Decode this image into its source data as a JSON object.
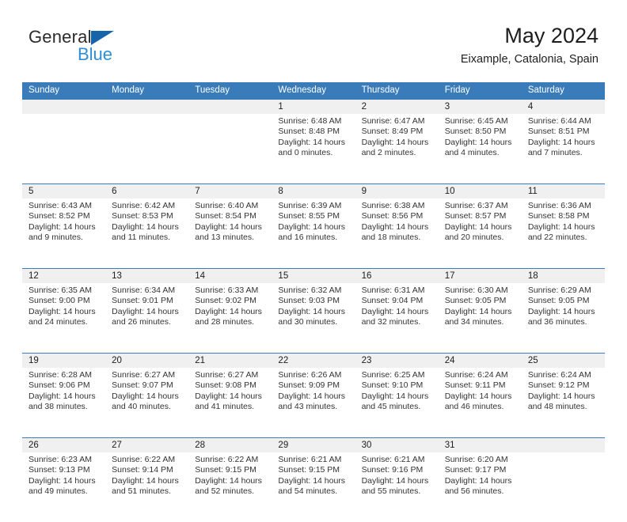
{
  "brand": {
    "name_part1": "General",
    "name_part2": "Blue",
    "triangle_color": "#1665ab",
    "blue_color": "#2e8fd6"
  },
  "header": {
    "title": "May 2024",
    "subtitle": "Eixample, Catalonia, Spain"
  },
  "theme": {
    "header_band": "#3a7cba",
    "daynum_band": "#f0f0f0",
    "text": "#333333"
  },
  "weekdays": [
    "Sunday",
    "Monday",
    "Tuesday",
    "Wednesday",
    "Thursday",
    "Friday",
    "Saturday"
  ],
  "weeks": [
    [
      {
        "day": "",
        "sunrise": "",
        "sunset": "",
        "daylight1": "",
        "daylight2": ""
      },
      {
        "day": "",
        "sunrise": "",
        "sunset": "",
        "daylight1": "",
        "daylight2": ""
      },
      {
        "day": "",
        "sunrise": "",
        "sunset": "",
        "daylight1": "",
        "daylight2": ""
      },
      {
        "day": "1",
        "sunrise": "Sunrise: 6:48 AM",
        "sunset": "Sunset: 8:48 PM",
        "daylight1": "Daylight: 14 hours",
        "daylight2": "and 0 minutes."
      },
      {
        "day": "2",
        "sunrise": "Sunrise: 6:47 AM",
        "sunset": "Sunset: 8:49 PM",
        "daylight1": "Daylight: 14 hours",
        "daylight2": "and 2 minutes."
      },
      {
        "day": "3",
        "sunrise": "Sunrise: 6:45 AM",
        "sunset": "Sunset: 8:50 PM",
        "daylight1": "Daylight: 14 hours",
        "daylight2": "and 4 minutes."
      },
      {
        "day": "4",
        "sunrise": "Sunrise: 6:44 AM",
        "sunset": "Sunset: 8:51 PM",
        "daylight1": "Daylight: 14 hours",
        "daylight2": "and 7 minutes."
      }
    ],
    [
      {
        "day": "5",
        "sunrise": "Sunrise: 6:43 AM",
        "sunset": "Sunset: 8:52 PM",
        "daylight1": "Daylight: 14 hours",
        "daylight2": "and 9 minutes."
      },
      {
        "day": "6",
        "sunrise": "Sunrise: 6:42 AM",
        "sunset": "Sunset: 8:53 PM",
        "daylight1": "Daylight: 14 hours",
        "daylight2": "and 11 minutes."
      },
      {
        "day": "7",
        "sunrise": "Sunrise: 6:40 AM",
        "sunset": "Sunset: 8:54 PM",
        "daylight1": "Daylight: 14 hours",
        "daylight2": "and 13 minutes."
      },
      {
        "day": "8",
        "sunrise": "Sunrise: 6:39 AM",
        "sunset": "Sunset: 8:55 PM",
        "daylight1": "Daylight: 14 hours",
        "daylight2": "and 16 minutes."
      },
      {
        "day": "9",
        "sunrise": "Sunrise: 6:38 AM",
        "sunset": "Sunset: 8:56 PM",
        "daylight1": "Daylight: 14 hours",
        "daylight2": "and 18 minutes."
      },
      {
        "day": "10",
        "sunrise": "Sunrise: 6:37 AM",
        "sunset": "Sunset: 8:57 PM",
        "daylight1": "Daylight: 14 hours",
        "daylight2": "and 20 minutes."
      },
      {
        "day": "11",
        "sunrise": "Sunrise: 6:36 AM",
        "sunset": "Sunset: 8:58 PM",
        "daylight1": "Daylight: 14 hours",
        "daylight2": "and 22 minutes."
      }
    ],
    [
      {
        "day": "12",
        "sunrise": "Sunrise: 6:35 AM",
        "sunset": "Sunset: 9:00 PM",
        "daylight1": "Daylight: 14 hours",
        "daylight2": "and 24 minutes."
      },
      {
        "day": "13",
        "sunrise": "Sunrise: 6:34 AM",
        "sunset": "Sunset: 9:01 PM",
        "daylight1": "Daylight: 14 hours",
        "daylight2": "and 26 minutes."
      },
      {
        "day": "14",
        "sunrise": "Sunrise: 6:33 AM",
        "sunset": "Sunset: 9:02 PM",
        "daylight1": "Daylight: 14 hours",
        "daylight2": "and 28 minutes."
      },
      {
        "day": "15",
        "sunrise": "Sunrise: 6:32 AM",
        "sunset": "Sunset: 9:03 PM",
        "daylight1": "Daylight: 14 hours",
        "daylight2": "and 30 minutes."
      },
      {
        "day": "16",
        "sunrise": "Sunrise: 6:31 AM",
        "sunset": "Sunset: 9:04 PM",
        "daylight1": "Daylight: 14 hours",
        "daylight2": "and 32 minutes."
      },
      {
        "day": "17",
        "sunrise": "Sunrise: 6:30 AM",
        "sunset": "Sunset: 9:05 PM",
        "daylight1": "Daylight: 14 hours",
        "daylight2": "and 34 minutes."
      },
      {
        "day": "18",
        "sunrise": "Sunrise: 6:29 AM",
        "sunset": "Sunset: 9:05 PM",
        "daylight1": "Daylight: 14 hours",
        "daylight2": "and 36 minutes."
      }
    ],
    [
      {
        "day": "19",
        "sunrise": "Sunrise: 6:28 AM",
        "sunset": "Sunset: 9:06 PM",
        "daylight1": "Daylight: 14 hours",
        "daylight2": "and 38 minutes."
      },
      {
        "day": "20",
        "sunrise": "Sunrise: 6:27 AM",
        "sunset": "Sunset: 9:07 PM",
        "daylight1": "Daylight: 14 hours",
        "daylight2": "and 40 minutes."
      },
      {
        "day": "21",
        "sunrise": "Sunrise: 6:27 AM",
        "sunset": "Sunset: 9:08 PM",
        "daylight1": "Daylight: 14 hours",
        "daylight2": "and 41 minutes."
      },
      {
        "day": "22",
        "sunrise": "Sunrise: 6:26 AM",
        "sunset": "Sunset: 9:09 PM",
        "daylight1": "Daylight: 14 hours",
        "daylight2": "and 43 minutes."
      },
      {
        "day": "23",
        "sunrise": "Sunrise: 6:25 AM",
        "sunset": "Sunset: 9:10 PM",
        "daylight1": "Daylight: 14 hours",
        "daylight2": "and 45 minutes."
      },
      {
        "day": "24",
        "sunrise": "Sunrise: 6:24 AM",
        "sunset": "Sunset: 9:11 PM",
        "daylight1": "Daylight: 14 hours",
        "daylight2": "and 46 minutes."
      },
      {
        "day": "25",
        "sunrise": "Sunrise: 6:24 AM",
        "sunset": "Sunset: 9:12 PM",
        "daylight1": "Daylight: 14 hours",
        "daylight2": "and 48 minutes."
      }
    ],
    [
      {
        "day": "26",
        "sunrise": "Sunrise: 6:23 AM",
        "sunset": "Sunset: 9:13 PM",
        "daylight1": "Daylight: 14 hours",
        "daylight2": "and 49 minutes."
      },
      {
        "day": "27",
        "sunrise": "Sunrise: 6:22 AM",
        "sunset": "Sunset: 9:14 PM",
        "daylight1": "Daylight: 14 hours",
        "daylight2": "and 51 minutes."
      },
      {
        "day": "28",
        "sunrise": "Sunrise: 6:22 AM",
        "sunset": "Sunset: 9:15 PM",
        "daylight1": "Daylight: 14 hours",
        "daylight2": "and 52 minutes."
      },
      {
        "day": "29",
        "sunrise": "Sunrise: 6:21 AM",
        "sunset": "Sunset: 9:15 PM",
        "daylight1": "Daylight: 14 hours",
        "daylight2": "and 54 minutes."
      },
      {
        "day": "30",
        "sunrise": "Sunrise: 6:21 AM",
        "sunset": "Sunset: 9:16 PM",
        "daylight1": "Daylight: 14 hours",
        "daylight2": "and 55 minutes."
      },
      {
        "day": "31",
        "sunrise": "Sunrise: 6:20 AM",
        "sunset": "Sunset: 9:17 PM",
        "daylight1": "Daylight: 14 hours",
        "daylight2": "and 56 minutes."
      },
      {
        "day": "",
        "sunrise": "",
        "sunset": "",
        "daylight1": "",
        "daylight2": ""
      }
    ]
  ]
}
